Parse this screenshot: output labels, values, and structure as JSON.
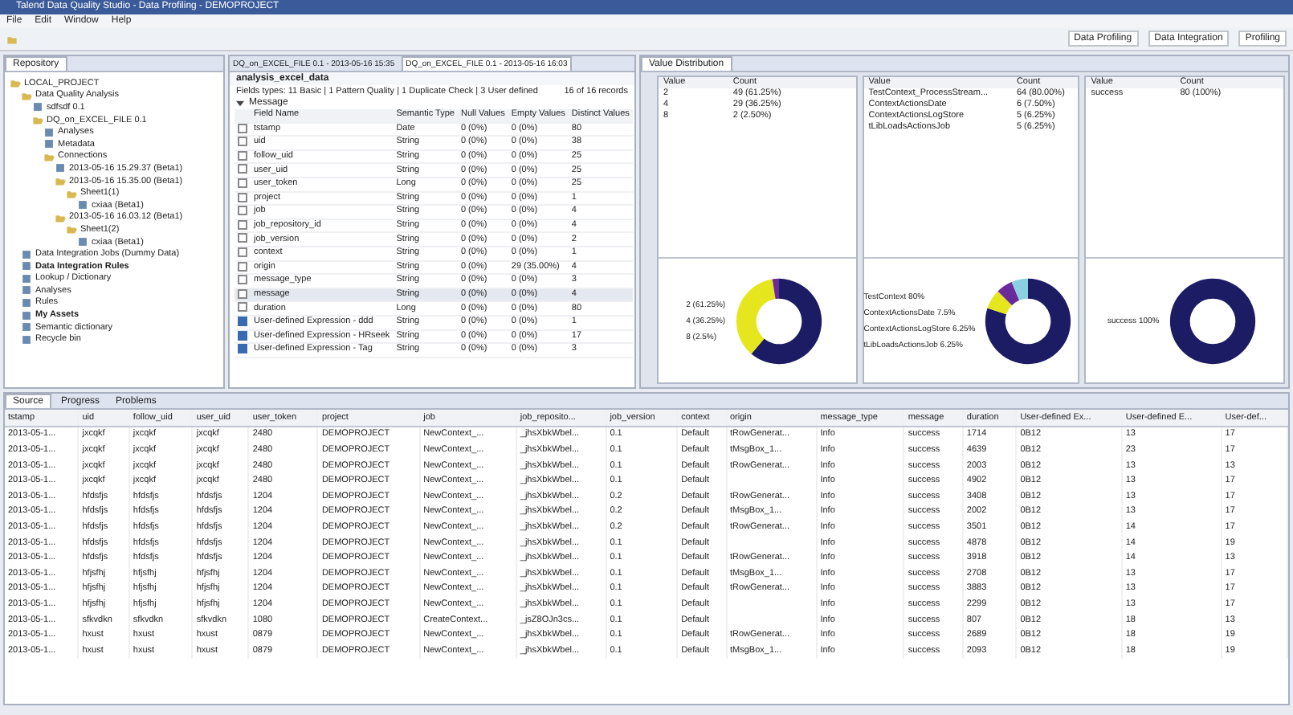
{
  "window": {
    "title": "Talend Data Quality Studio - Data Profiling - DEMOPROJECT"
  },
  "menu": [
    "File",
    "Edit",
    "Window",
    "Help"
  ],
  "perspectives": [
    "Data Profiling",
    "Data Integration",
    "Profiling"
  ],
  "repository": {
    "title": "Repository",
    "tree": [
      {
        "label": "LOCAL_PROJECT",
        "expanded": true,
        "children": [
          {
            "label": "Data Quality Analysis",
            "expanded": true,
            "children": [
              {
                "label": "sdfsdf 0.1"
              },
              {
                "label": "DQ_on_EXCEL_FILE 0.1",
                "expanded": true,
                "children": [
                  {
                    "label": "Analyses"
                  },
                  {
                    "label": "Metadata"
                  },
                  {
                    "label": "Connections",
                    "expanded": true,
                    "children": [
                      {
                        "label": "2013-05-16 15.29.37 (Beta1)"
                      },
                      {
                        "label": "2013-05-16 15.35.00 (Beta1)",
                        "expanded": true,
                        "children": [
                          {
                            "label": "Sheet1(1)",
                            "expanded": true,
                            "children": [
                              {
                                "label": "cxiaa (Beta1)"
                              }
                            ]
                          }
                        ]
                      },
                      {
                        "label": "2013-05-16 16.03.12 (Beta1)",
                        "expanded": true,
                        "children": [
                          {
                            "label": "Sheet1(2)",
                            "expanded": true,
                            "children": [
                              {
                                "label": "cxiaa (Beta1)"
                              }
                            ]
                          }
                        ]
                      }
                    ]
                  }
                ]
              }
            ]
          },
          {
            "label": "Data Integration Jobs (Dummy Data)"
          },
          {
            "label": "Data Integration Rules",
            "bold": true
          },
          {
            "label": "Lookup / Dictionary"
          },
          {
            "label": "Analyses"
          },
          {
            "label": "Rules"
          },
          {
            "label": "My Assets",
            "bold": true
          },
          {
            "label": "Semantic dictionary"
          },
          {
            "label": "Recycle bin"
          }
        ]
      }
    ]
  },
  "editor": {
    "tabs": [
      {
        "label": "DQ_on_EXCEL_FILE 0.1 - 2013-05-16 15:35",
        "selected": false
      },
      {
        "label": "DQ_on_EXCEL_FILE 0.1 - 2013-05-16 16:03",
        "selected": true
      }
    ],
    "title": "analysis_excel_data",
    "summary": "Fields types: 11 Basic | 1 Pattern Quality | 1 Duplicate Check | 3 User defined",
    "records": "16 of 16 records",
    "group": {
      "label": "Message",
      "expanded": true
    },
    "columns": [
      "Field Name",
      "Semantic Type",
      "Null Values",
      "Empty Values",
      "Distinct Values"
    ],
    "rows": [
      {
        "checked": false,
        "selected": false,
        "cells": [
          "tstamp",
          "Date",
          "0 (0%)",
          "0 (0%)",
          "80"
        ]
      },
      {
        "checked": false,
        "selected": false,
        "cells": [
          "uid",
          "String",
          "0 (0%)",
          "0 (0%)",
          "38"
        ]
      },
      {
        "checked": false,
        "selected": false,
        "cells": [
          "follow_uid",
          "String",
          "0 (0%)",
          "0 (0%)",
          "25"
        ]
      },
      {
        "checked": false,
        "selected": false,
        "cells": [
          "user_uid",
          "String",
          "0 (0%)",
          "0 (0%)",
          "25"
        ]
      },
      {
        "checked": false,
        "selected": false,
        "cells": [
          "user_token",
          "Long",
          "0 (0%)",
          "0 (0%)",
          "25"
        ]
      },
      {
        "checked": false,
        "selected": false,
        "cells": [
          "project",
          "String",
          "0 (0%)",
          "0 (0%)",
          "1"
        ]
      },
      {
        "checked": false,
        "selected": false,
        "cells": [
          "job",
          "String",
          "0 (0%)",
          "0 (0%)",
          "4"
        ]
      },
      {
        "checked": false,
        "selected": false,
        "cells": [
          "job_repository_id",
          "String",
          "0 (0%)",
          "0 (0%)",
          "4"
        ]
      },
      {
        "checked": false,
        "selected": false,
        "cells": [
          "job_version",
          "String",
          "0 (0%)",
          "0 (0%)",
          "2"
        ]
      },
      {
        "checked": false,
        "selected": false,
        "cells": [
          "context",
          "String",
          "0 (0%)",
          "0 (0%)",
          "1"
        ]
      },
      {
        "checked": false,
        "selected": false,
        "cells": [
          "origin",
          "String",
          "0 (0%)",
          "29 (35.00%)",
          "4"
        ]
      },
      {
        "checked": false,
        "selected": false,
        "cells": [
          "message_type",
          "String",
          "0 (0%)",
          "0 (0%)",
          "3"
        ]
      },
      {
        "checked": false,
        "selected": true,
        "cells": [
          "message",
          "String",
          "0 (0%)",
          "0 (0%)",
          "4"
        ]
      },
      {
        "checked": false,
        "selected": false,
        "cells": [
          "duration",
          "Long",
          "0 (0%)",
          "0 (0%)",
          "80"
        ]
      },
      {
        "checked": true,
        "selected": false,
        "cells": [
          "User-defined Expression - ddd",
          "String",
          "0 (0%)",
          "0 (0%)",
          "1"
        ]
      },
      {
        "checked": true,
        "selected": false,
        "cells": [
          "User-defined Expression - HRseek",
          "String",
          "0 (0%)",
          "0 (0%)",
          "17"
        ]
      },
      {
        "checked": true,
        "selected": false,
        "cells": [
          "User-defined Expression - Tag",
          "String",
          "0 (0%)",
          "0 (0%)",
          "3"
        ]
      }
    ]
  },
  "distribution": {
    "title": "Value Distribution",
    "panels": [
      {
        "columns": [
          "Value",
          "Count"
        ],
        "rows": [
          [
            "2",
            "49 (61.25%)"
          ],
          [
            "4",
            "29 (36.25%)"
          ],
          [
            "8",
            "2 (2.50%)"
          ]
        ],
        "chart_data": {
          "type": "donut",
          "categories": [
            "2 (61.25%)",
            "4 (36.25%)",
            "8 (2.5%)"
          ],
          "series": [
            {
              "values": [
                61.25,
                36.25,
                2.5
              ]
            }
          ]
        }
      },
      {
        "columns": [
          "Value",
          "Count"
        ],
        "rows": [
          [
            "TestContext_ProcessStream...",
            "64 (80.00%)"
          ],
          [
            "ContextActionsDate",
            "6 (7.50%)"
          ],
          [
            "ContextActionsLogStore",
            "5 (6.25%)"
          ],
          [
            "tLibLoadsActionsJob",
            "5 (6.25%)"
          ]
        ],
        "chart_data": {
          "type": "donut",
          "categories": [
            "TestContext 80%",
            "ContextActionsDate 7.5%",
            "ContextActionsLogStore 6.25%",
            "tLibLoadsActionsJob 6.25%"
          ],
          "series": [
            {
              "values": [
                80,
                7.5,
                6.25,
                6.25
              ]
            }
          ]
        }
      },
      {
        "columns": [
          "Value",
          "Count"
        ],
        "rows": [
          [
            "success",
            "80 (100%)"
          ]
        ],
        "legend": [
          "success 100%"
        ]
      }
    ]
  },
  "bottom": {
    "tabs": [
      {
        "label": "Source",
        "selected": true
      },
      {
        "label": "Progress",
        "selected": false
      },
      {
        "label": "Problems",
        "selected": false
      }
    ],
    "columns": [
      "tstamp",
      "uid",
      "follow_uid",
      "user_uid",
      "user_token",
      "project",
      "job",
      "job_reposito...",
      "job_version",
      "context",
      "origin",
      "message_type",
      "message",
      "duration",
      "User-defined Ex...",
      "User-defined E...",
      "User-def..."
    ],
    "rows": [
      [
        "2013-05-1...",
        "jxcqkf",
        "jxcqkf",
        "jxcqkf",
        "2480",
        "DEMOPROJECT",
        "NewContext_...",
        "_jhsXbkWbel...",
        "0.1",
        "Default",
        "tRowGenerat...",
        "Info",
        "success",
        "1714",
        "0B12",
        "13",
        "17"
      ],
      [
        "2013-05-1...",
        "jxcqkf",
        "jxcqkf",
        "jxcqkf",
        "2480",
        "DEMOPROJECT",
        "NewContext_...",
        "_jhsXbkWbel...",
        "0.1",
        "Default",
        "tMsgBox_1...",
        "Info",
        "success",
        "4639",
        "0B12",
        "23",
        "17"
      ],
      [
        "2013-05-1...",
        "jxcqkf",
        "jxcqkf",
        "jxcqkf",
        "2480",
        "DEMOPROJECT",
        "NewContext_...",
        "_jhsXbkWbel...",
        "0.1",
        "Default",
        "tRowGenerat...",
        "Info",
        "success",
        "2003",
        "0B12",
        "13",
        "13"
      ],
      [
        "2013-05-1...",
        "jxcqkf",
        "jxcqkf",
        "jxcqkf",
        "2480",
        "DEMOPROJECT",
        "NewContext_...",
        "_jhsXbkWbel...",
        "0.1",
        "Default",
        "",
        "Info",
        "success",
        "4902",
        "0B12",
        "13",
        "17"
      ],
      [
        "2013-05-1...",
        "hfdsfjs",
        "hfdsfjs",
        "hfdsfjs",
        "1204",
        "DEMOPROJECT",
        "NewContext_...",
        "_jhsXbkWbel...",
        "0.2",
        "Default",
        "tRowGenerat...",
        "Info",
        "success",
        "3408",
        "0B12",
        "13",
        "17"
      ],
      [
        "2013-05-1...",
        "hfdsfjs",
        "hfdsfjs",
        "hfdsfjs",
        "1204",
        "DEMOPROJECT",
        "NewContext_...",
        "_jhsXbkWbel...",
        "0.2",
        "Default",
        "tMsgBox_1...",
        "Info",
        "success",
        "2002",
        "0B12",
        "13",
        "17"
      ],
      [
        "2013-05-1...",
        "hfdsfjs",
        "hfdsfjs",
        "hfdsfjs",
        "1204",
        "DEMOPROJECT",
        "NewContext_...",
        "_jhsXbkWbel...",
        "0.2",
        "Default",
        "tRowGenerat...",
        "Info",
        "success",
        "3501",
        "0B12",
        "14",
        "17"
      ],
      [
        "2013-05-1...",
        "hfdsfjs",
        "hfdsfjs",
        "hfdsfjs",
        "1204",
        "DEMOPROJECT",
        "NewContext_...",
        "_jhsXbkWbel...",
        "0.1",
        "Default",
        "",
        "Info",
        "success",
        "4878",
        "0B12",
        "14",
        "19"
      ],
      [
        "2013-05-1...",
        "hfdsfjs",
        "hfdsfjs",
        "hfdsfjs",
        "1204",
        "DEMOPROJECT",
        "NewContext_...",
        "_jhsXbkWbel...",
        "0.1",
        "Default",
        "tRowGenerat...",
        "Info",
        "success",
        "3918",
        "0B12",
        "14",
        "13"
      ],
      [
        "2013-05-1...",
        "hfjsfhj",
        "hfjsfhj",
        "hfjsfhj",
        "1204",
        "DEMOPROJECT",
        "NewContext_...",
        "_jhsXbkWbel...",
        "0.1",
        "Default",
        "tMsgBox_1...",
        "Info",
        "success",
        "2708",
        "0B12",
        "13",
        "17"
      ],
      [
        "2013-05-1...",
        "hfjsfhj",
        "hfjsfhj",
        "hfjsfhj",
        "1204",
        "DEMOPROJECT",
        "NewContext_...",
        "_jhsXbkWbel...",
        "0.1",
        "Default",
        "tRowGenerat...",
        "Info",
        "success",
        "3883",
        "0B12",
        "13",
        "17"
      ],
      [
        "2013-05-1...",
        "hfjsfhj",
        "hfjsfhj",
        "hfjsfhj",
        "1204",
        "DEMOPROJECT",
        "NewContext_...",
        "_jhsXbkWbel...",
        "0.1",
        "Default",
        "",
        "Info",
        "success",
        "2299",
        "0B12",
        "13",
        "17"
      ],
      [
        "2013-05-1...",
        "sfkvdkn",
        "sfkvdkn",
        "sfkvdkn",
        "1080",
        "DEMOPROJECT",
        "CreateContext...",
        "_jsZ8OJn3cs...",
        "0.1",
        "Default",
        "",
        "Info",
        "success",
        "807",
        "0B12",
        "18",
        "13"
      ],
      [
        "2013-05-1...",
        "hxust",
        "hxust",
        "hxust",
        "0879",
        "DEMOPROJECT",
        "NewContext_...",
        "_jhsXbkWbel...",
        "0.1",
        "Default",
        "tRowGenerat...",
        "Info",
        "success",
        "2689",
        "0B12",
        "18",
        "19"
      ],
      [
        "2013-05-1...",
        "hxust",
        "hxust",
        "hxust",
        "0879",
        "DEMOPROJECT",
        "NewContext_...",
        "_jhsXbkWbel...",
        "0.1",
        "Default",
        "tMsgBox_1...",
        "Info",
        "success",
        "2093",
        "0B12",
        "18",
        "19"
      ]
    ]
  }
}
